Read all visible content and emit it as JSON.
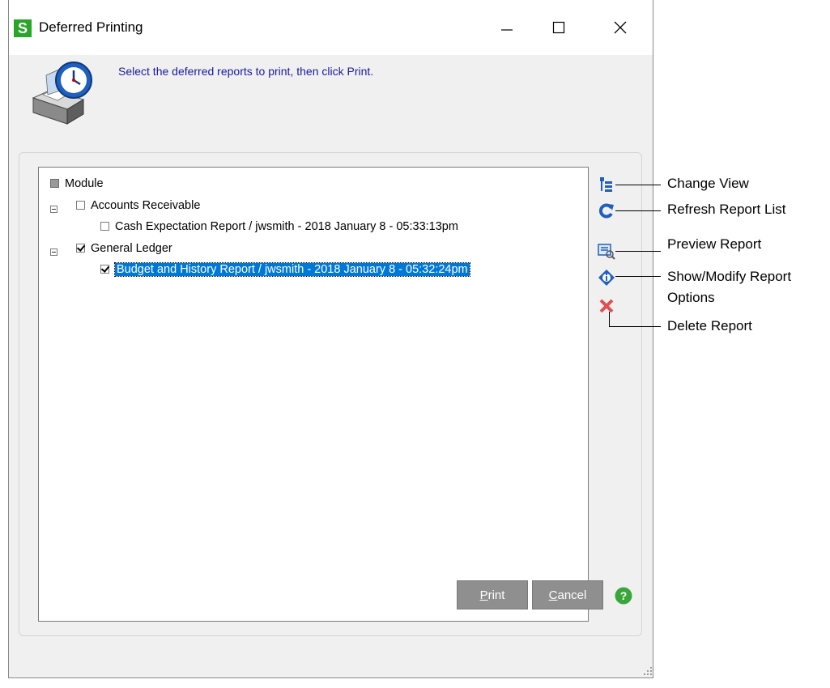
{
  "window": {
    "app_icon_letter": "S",
    "title": "Deferred Printing",
    "instruction": "Select the deferred reports to print, then click Print."
  },
  "tree": {
    "root": {
      "label": "Module"
    },
    "groups": [
      {
        "label": "Accounts Receivable",
        "checked": false,
        "children": [
          {
            "label": "Cash Expectation Report  /  jwsmith - 2018 January 8 - 05:33:13pm",
            "checked": false,
            "selected": false
          }
        ]
      },
      {
        "label": "General Ledger",
        "checked": true,
        "children": [
          {
            "label": "Budget and History Report  /  jwsmith - 2018 January 8 - 05:32:24pm",
            "checked": true,
            "selected": true
          }
        ]
      }
    ]
  },
  "toolbar_icons": [
    "change-view-icon",
    "refresh-icon",
    "preview-icon",
    "options-icon",
    "delete-icon"
  ],
  "buttons": {
    "print": {
      "accel": "P",
      "rest": "rint"
    },
    "cancel": {
      "accel": "C",
      "rest": "ancel"
    }
  },
  "callouts": {
    "change_view": "Change View",
    "refresh": "Refresh Report List",
    "preview": "Preview Report",
    "options_line1": "Show/Modify Report",
    "options_line2": "Options",
    "delete": "Delete Report"
  },
  "colors": {
    "selection": "#0078d7",
    "instruction_text": "#1a1aa0",
    "app_icon": "#2aa52a",
    "button_bg": "#8f8f8f",
    "help": "#3aa63a"
  }
}
